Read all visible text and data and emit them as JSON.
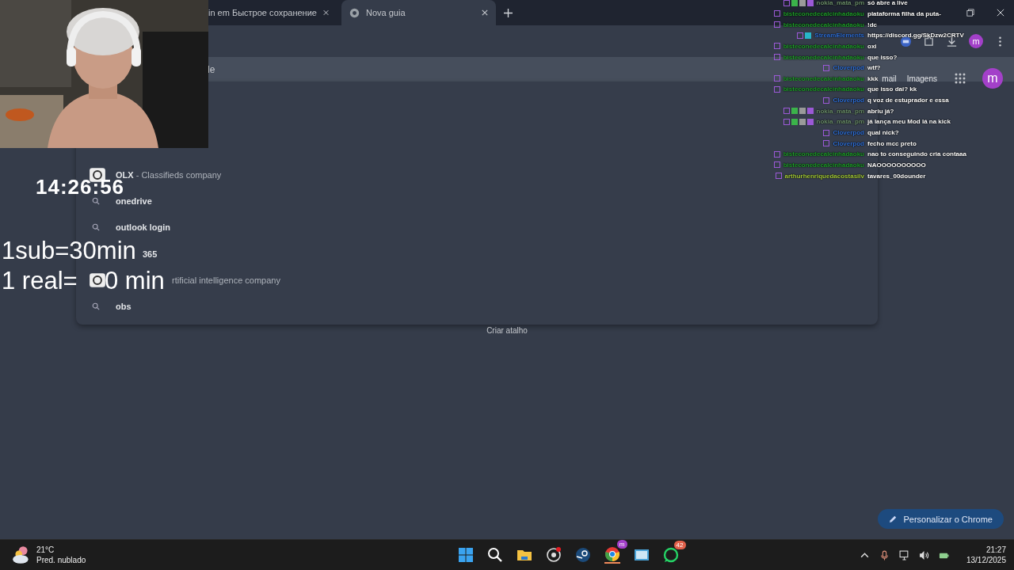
{
  "tabs": [
    {
      "label": "in em Быстрое сохранение",
      "selected": false
    },
    {
      "label": "Nova guia",
      "selected": true
    }
  ],
  "toolbar": {
    "profile": "m"
  },
  "omnibox": {
    "value": "le"
  },
  "header_links": [
    "mail",
    "Imagens"
  ],
  "header_profile": "m",
  "suggestions": [
    {
      "kind": "site",
      "title": "OLX",
      "detail": "- Classifieds company"
    },
    {
      "kind": "search",
      "text": "onedrive"
    },
    {
      "kind": "search",
      "text": "outlook login"
    },
    {
      "kind": "covered-search",
      "text": "365"
    },
    {
      "kind": "covered-site",
      "text": "rtificial intelligence company"
    },
    {
      "kind": "search",
      "text": "obs"
    }
  ],
  "shortcut_label": "Criar atalho",
  "customize_button": "Personalizar o Chrome",
  "overlay": {
    "timer": "14:26:56",
    "line_1": "1sub=30min",
    "line_2_start": "1 real=",
    "line_2_end": "0 min"
  },
  "chat": [
    {
      "kind": "mod",
      "name": "nokia_mata_pm",
      "color": "#6b8f6b",
      "message": "só abre a live"
    },
    {
      "kind": "viewer",
      "name": "bisteconedecalcinhadaoku",
      "color": "#1f9e2a",
      "message": "plataforma filha da puta-"
    },
    {
      "kind": "viewer",
      "name": "bisteconedecalcinhadaoku",
      "color": "#1f9e2a",
      "message": "!dc"
    },
    {
      "kind": "bot",
      "name": "StreamElements",
      "color": "#2f6fd6",
      "message": "https://discord.gg/SkDzw2CRTV"
    },
    {
      "kind": "viewer",
      "name": "bisteconedecalcinhadaoku",
      "color": "#1f9e2a",
      "message": "oxi"
    },
    {
      "kind": "viewer",
      "name": "bisteconedecalcinhadaoku",
      "color": "#1f9e2a",
      "message": "que isso?"
    },
    {
      "kind": "viewer",
      "name": "Cloverpod",
      "color": "#2f6fd6",
      "message": "wtf?"
    },
    {
      "kind": "viewer",
      "name": "bisteconedecalcinhadaoku",
      "color": "#1f9e2a",
      "message": "kkk"
    },
    {
      "kind": "viewer",
      "name": "bisteconedecalcinhadaoku",
      "color": "#1f9e2a",
      "message": "que isso dai? kk"
    },
    {
      "kind": "viewer",
      "name": "Cloverpod",
      "color": "#2f6fd6",
      "message": "q voz de estuprador e essa"
    },
    {
      "kind": "mod",
      "name": "nokia_mata_pm",
      "color": "#6b8f6b",
      "message": "abriu já?"
    },
    {
      "kind": "mod",
      "name": "nokia_mata_pm",
      "color": "#6b8f6b",
      "message": "já lança meu Mod lá na kick"
    },
    {
      "kind": "viewer",
      "name": "Cloverpod",
      "color": "#2f6fd6",
      "message": "qual nick?"
    },
    {
      "kind": "viewer",
      "name": "Cloverpod",
      "color": "#2f6fd6",
      "message": "fecho mcc preto"
    },
    {
      "kind": "viewer",
      "name": "bisteconedecalcinhadaoku",
      "color": "#1f9e2a",
      "message": "nao to conseguindo cria contaaa"
    },
    {
      "kind": "viewer",
      "name": "bisteconedecalcinhadaoku",
      "color": "#1f9e2a",
      "message": "NAOOOOOOOOOO"
    },
    {
      "kind": "viewer",
      "name": "arthurhenriquedacostasilv",
      "color": "#a3c93a",
      "message": "tavares_00dounder"
    }
  ],
  "weather": {
    "temp": "21°C",
    "condition": "Pred. nublado"
  },
  "taskbar_badges": {
    "chrome": "m",
    "whatsapp": "42"
  },
  "clock": {
    "time": "21:27",
    "date": "13/12/2025"
  }
}
